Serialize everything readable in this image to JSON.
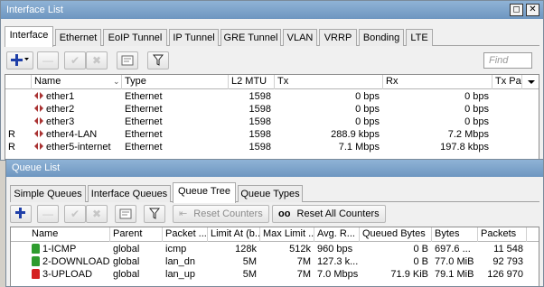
{
  "interface_window": {
    "title": "Interface List",
    "controls": {
      "restore": "◻",
      "close": "✕"
    },
    "tabs": [
      "Interface",
      "Ethernet",
      "EoIP Tunnel",
      "IP Tunnel",
      "GRE Tunnel",
      "VLAN",
      "VRRP",
      "Bonding",
      "LTE"
    ],
    "active_tab": "Interface",
    "find_placeholder": "Find",
    "columns": [
      "",
      "Name",
      "Type",
      "L2 MTU",
      "Tx",
      "Rx",
      "Tx Pac"
    ],
    "rows": [
      {
        "flag": "",
        "name": "ether1",
        "type": "Ethernet",
        "l2mtu": "1598",
        "tx": "0 bps",
        "rx": "0 bps"
      },
      {
        "flag": "",
        "name": "ether2",
        "type": "Ethernet",
        "l2mtu": "1598",
        "tx": "0 bps",
        "rx": "0 bps"
      },
      {
        "flag": "",
        "name": "ether3",
        "type": "Ethernet",
        "l2mtu": "1598",
        "tx": "0 bps",
        "rx": "0 bps"
      },
      {
        "flag": "R",
        "name": "ether4-LAN",
        "type": "Ethernet",
        "l2mtu": "1598",
        "tx": "288.9 kbps",
        "rx": "7.2 Mbps"
      },
      {
        "flag": "R",
        "name": "ether5-internet",
        "type": "Ethernet",
        "l2mtu": "1598",
        "tx": "7.1 Mbps",
        "rx": "197.8 kbps"
      }
    ]
  },
  "queue_window": {
    "title": "Queue List",
    "tabs": [
      "Simple Queues",
      "Interface Queues",
      "Queue Tree",
      "Queue Types"
    ],
    "active_tab": "Queue Tree",
    "buttons": {
      "reset_counters": "Reset Counters",
      "reset_all_counters": "Reset All Counters"
    },
    "columns": [
      "Name",
      "Parent",
      "Packet ...",
      "Limit At (b...",
      "Max Limit ...",
      "Avg. R...",
      "Queued Bytes",
      "Bytes",
      "Packets"
    ],
    "rows": [
      {
        "name": "1-ICMP",
        "icon_color": "#2e9c2e",
        "parent": "global",
        "packet_mark": "icmp",
        "limit_at": "128k",
        "max_limit": "512k",
        "avg_rate": "960 bps",
        "queued_bytes": "0 B",
        "bytes": "697.6 ...",
        "packets": "11 548"
      },
      {
        "name": "2-DOWNLOAD",
        "icon_color": "#2e9c2e",
        "parent": "global",
        "packet_mark": "lan_dn",
        "limit_at": "5M",
        "max_limit": "7M",
        "avg_rate": "127.3 k...",
        "queued_bytes": "0 B",
        "bytes": "77.0 MiB",
        "packets": "92 793"
      },
      {
        "name": "3-UPLOAD",
        "icon_color": "#d42020",
        "parent": "global",
        "packet_mark": "lan_up",
        "limit_at": "5M",
        "max_limit": "7M",
        "avg_rate": "7.0 Mbps",
        "queued_bytes": "71.9 KiB",
        "bytes": "79.1 MiB",
        "packets": "126 970"
      }
    ]
  }
}
